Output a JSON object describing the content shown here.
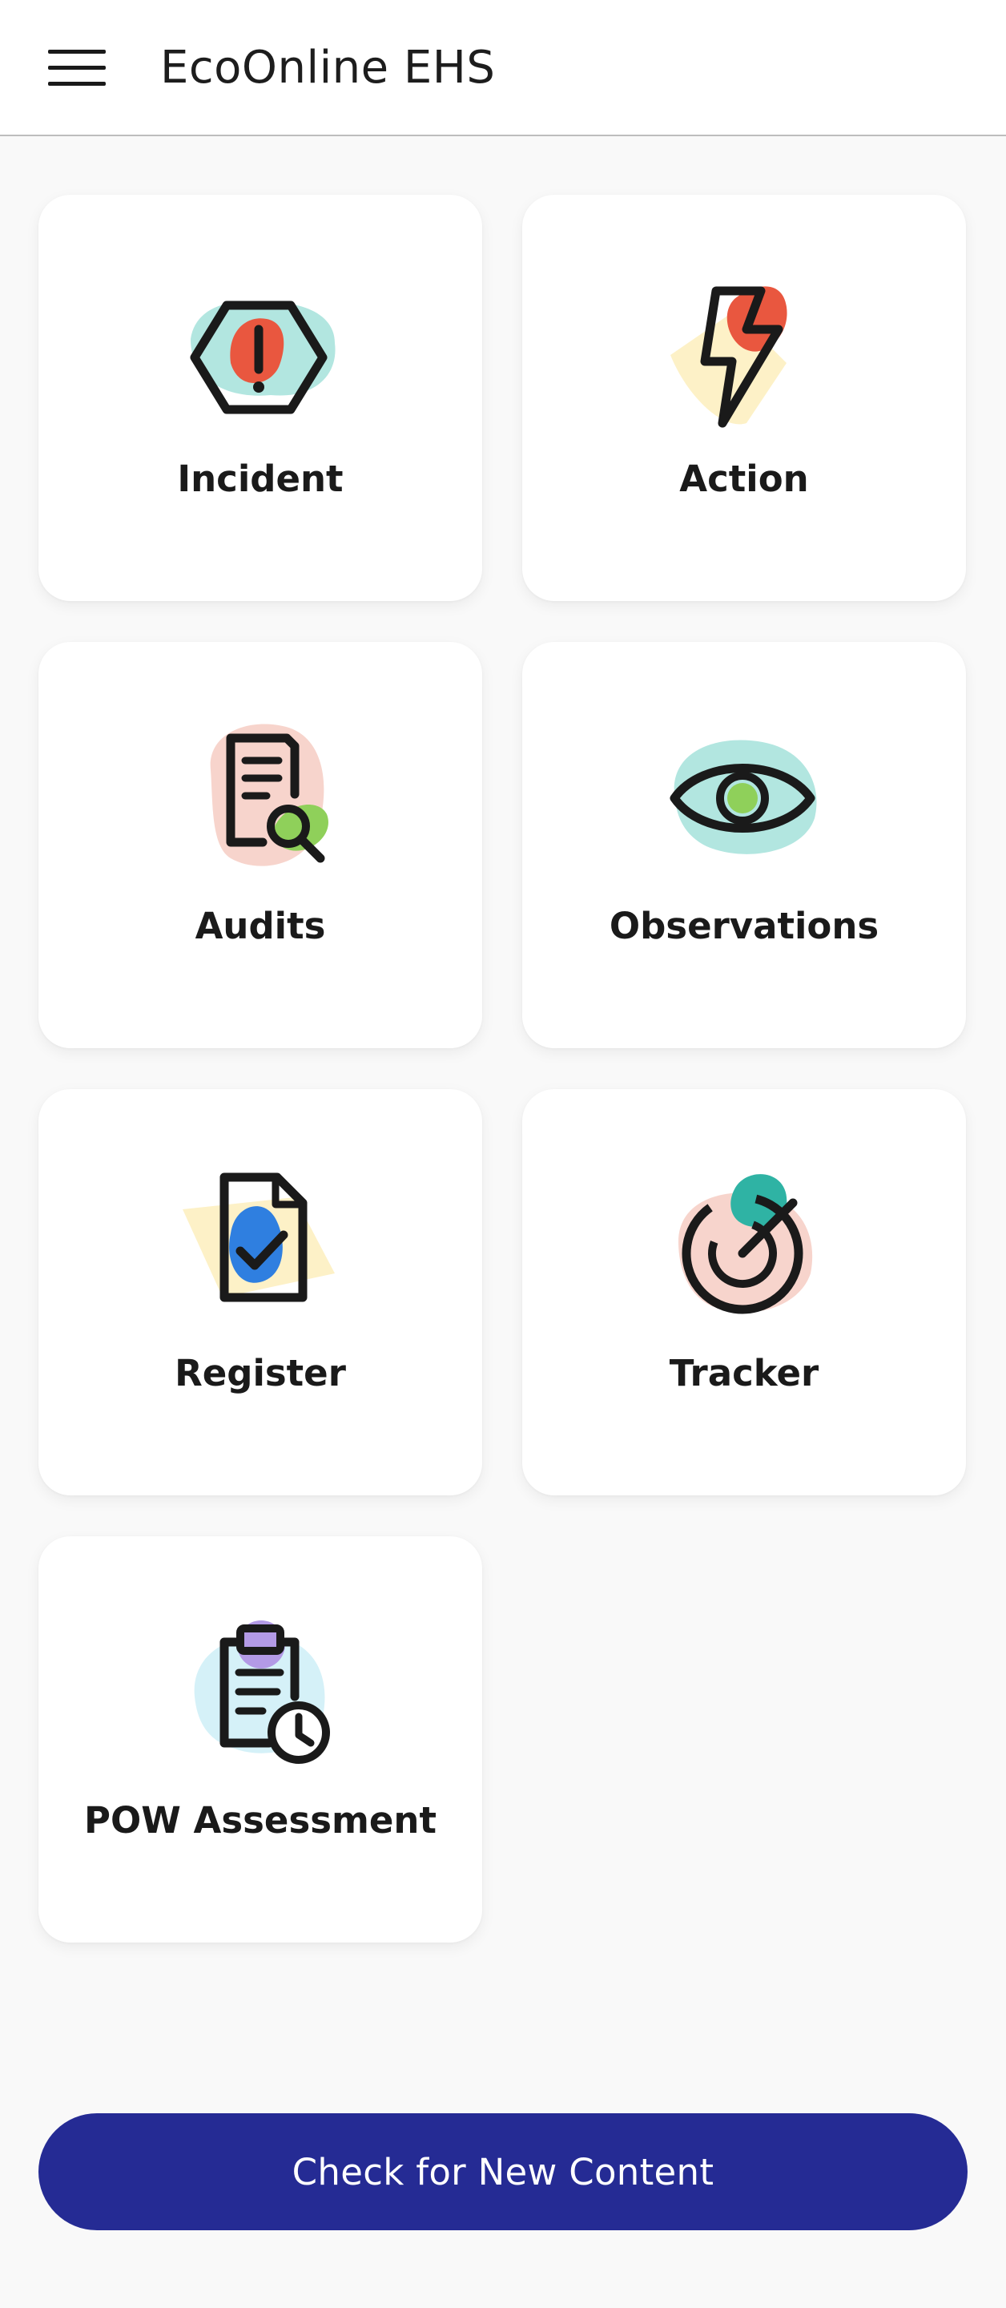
{
  "header": {
    "menu_icon": "hamburger-menu-icon",
    "title": "EcoOnline EHS"
  },
  "tiles": [
    {
      "label": "Incident",
      "icon": "incident-hexagon-alert-icon"
    },
    {
      "label": "Action",
      "icon": "action-lightning-bolt-icon"
    },
    {
      "label": "Audits",
      "icon": "audits-document-magnifier-icon"
    },
    {
      "label": "Observations",
      "icon": "observations-eye-icon"
    },
    {
      "label": "Register",
      "icon": "register-document-check-icon"
    },
    {
      "label": "Tracker",
      "icon": "tracker-target-icon"
    },
    {
      "label": "POW Assessment",
      "icon": "pow-assessment-clipboard-clock-icon"
    }
  ],
  "footer": {
    "button_label": "Check for New Content"
  },
  "colors": {
    "primary": "#252b94",
    "tile_background": "#ffffff",
    "page_background": "#f9f9f9",
    "icon_red": "#e9573f",
    "icon_teal": "#b2e6e0",
    "icon_yellow": "#fdf1c7",
    "icon_pink": "#f7d4cc",
    "icon_green": "#8fd05a",
    "icon_blue": "#2f7fe0",
    "icon_purple": "#b39ae6",
    "icon_dark_teal": "#2fb3a4"
  }
}
